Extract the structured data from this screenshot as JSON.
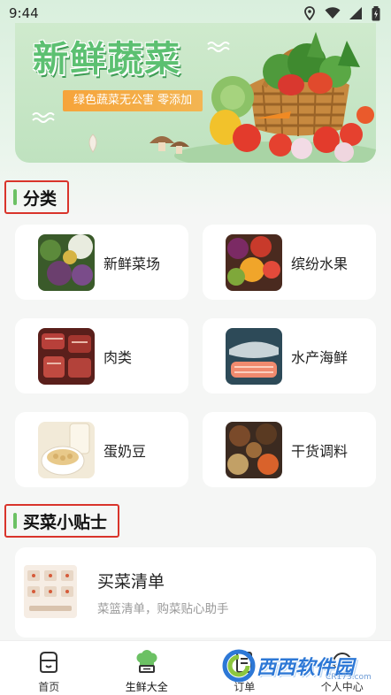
{
  "status_bar": {
    "time": "9:44"
  },
  "banner": {
    "title": "新鲜蔬菜",
    "subtitle": "绿色蔬菜无公害 零添加"
  },
  "categories_section": {
    "title": "分类",
    "items": [
      {
        "label": "新鲜菜场",
        "icon": "vegetables-photo"
      },
      {
        "label": "缤纷水果",
        "icon": "fruits-photo"
      },
      {
        "label": "肉类",
        "icon": "meat-photo"
      },
      {
        "label": "水产海鲜",
        "icon": "seafood-photo"
      },
      {
        "label": "蛋奶豆",
        "icon": "soybean-milk-photo"
      },
      {
        "label": "干货调料",
        "icon": "spices-photo"
      }
    ]
  },
  "tips_section": {
    "title": "买菜小贴士",
    "card": {
      "title": "买菜清单",
      "description": "菜篮清单，购菜贴心助手"
    }
  },
  "tabbar": {
    "tabs": [
      {
        "label": "首页",
        "icon": "home-icon",
        "active": false
      },
      {
        "label": "生鲜大全",
        "icon": "chef-hat-icon",
        "active": true
      },
      {
        "label": "订单",
        "icon": "order-icon",
        "active": false
      },
      {
        "label": "个人中心",
        "icon": "profile-icon",
        "active": false
      }
    ]
  },
  "watermark": {
    "text": "西西软件园",
    "sub": "CR173.com"
  },
  "colors": {
    "accent_green": "#6cc164",
    "highlight_red": "#d9342b",
    "banner_badge": "#f6a43b"
  }
}
